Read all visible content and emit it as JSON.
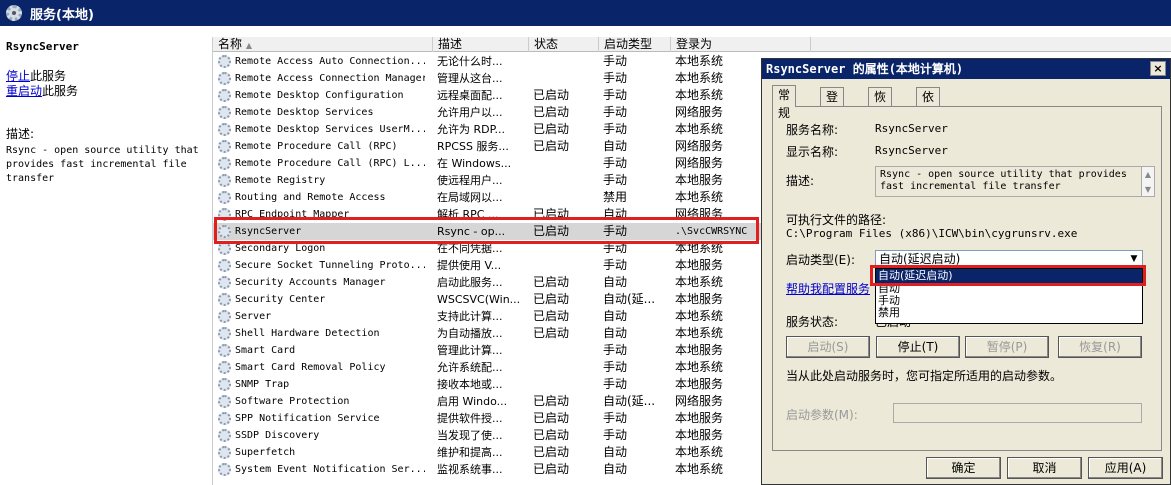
{
  "window": {
    "title": "服务(本地)",
    "icon": "gear-icon"
  },
  "left_pane": {
    "service_name": "RsyncServer",
    "stop_link": "停止",
    "stop_suffix": "此服务",
    "restart_link": "重启动",
    "restart_suffix": "此服务",
    "description_label": "描述:",
    "description": "Rsync - open source utility that provides fast incremental file transfer"
  },
  "columns": [
    "名称",
    "描述",
    "状态",
    "启动类型",
    "登录为"
  ],
  "rows": [
    {
      "name": "Remote Access Auto Connection...",
      "desc": "无论什么时...",
      "status": "",
      "startup": "手动",
      "logon": "本地系统"
    },
    {
      "name": "Remote Access Connection Manager",
      "desc": "管理从这台...",
      "status": "",
      "startup": "手动",
      "logon": "本地系统"
    },
    {
      "name": "Remote Desktop Configuration",
      "desc": "远程桌面配...",
      "status": "已启动",
      "startup": "手动",
      "logon": "本地系统"
    },
    {
      "name": "Remote Desktop Services",
      "desc": "允许用户以...",
      "status": "已启动",
      "startup": "手动",
      "logon": "网络服务"
    },
    {
      "name": "Remote Desktop Services UserM...",
      "desc": "允许为 RDP...",
      "status": "已启动",
      "startup": "手动",
      "logon": "本地系统"
    },
    {
      "name": "Remote Procedure Call (RPC)",
      "desc": "RPCSS 服务...",
      "status": "已启动",
      "startup": "自动",
      "logon": "网络服务"
    },
    {
      "name": "Remote Procedure Call (RPC) L...",
      "desc": "在 Windows...",
      "status": "",
      "startup": "手动",
      "logon": "网络服务"
    },
    {
      "name": "Remote Registry",
      "desc": "使远程用户...",
      "status": "",
      "startup": "手动",
      "logon": "本地服务"
    },
    {
      "name": "Routing and Remote Access",
      "desc": "在局域网以...",
      "status": "",
      "startup": "禁用",
      "logon": "本地系统"
    },
    {
      "name": "RPC Endpoint Mapper",
      "desc": "解析 RPC ...",
      "status": "已启动",
      "startup": "自动",
      "logon": "网络服务"
    },
    {
      "name": "RsyncServer",
      "desc": "Rsync - op...",
      "status": "已启动",
      "startup": "手动",
      "logon": ".\\SvcCWRSYNC",
      "selected": true
    },
    {
      "name": "Secondary Logon",
      "desc": "在不同凭据...",
      "status": "",
      "startup": "手动",
      "logon": "本地系统"
    },
    {
      "name": "Secure Socket Tunneling Proto...",
      "desc": "提供使用 V...",
      "status": "",
      "startup": "手动",
      "logon": "本地服务"
    },
    {
      "name": "Security Accounts Manager",
      "desc": "启动此服务...",
      "status": "已启动",
      "startup": "自动",
      "logon": "本地系统"
    },
    {
      "name": "Security Center",
      "desc": "WSCSVC(Win...",
      "status": "已启动",
      "startup": "自动(延...",
      "logon": "本地服务"
    },
    {
      "name": "Server",
      "desc": "支持此计算...",
      "status": "已启动",
      "startup": "自动",
      "logon": "本地系统"
    },
    {
      "name": "Shell Hardware Detection",
      "desc": "为自动播放...",
      "status": "已启动",
      "startup": "自动",
      "logon": "本地系统"
    },
    {
      "name": "Smart Card",
      "desc": "管理此计算...",
      "status": "",
      "startup": "手动",
      "logon": "本地服务"
    },
    {
      "name": "Smart Card Removal Policy",
      "desc": "允许系统配...",
      "status": "",
      "startup": "手动",
      "logon": "本地系统"
    },
    {
      "name": "SNMP Trap",
      "desc": "接收本地或...",
      "status": "",
      "startup": "手动",
      "logon": "本地服务"
    },
    {
      "name": "Software Protection",
      "desc": "启用 Windo...",
      "status": "已启动",
      "startup": "自动(延...",
      "logon": "网络服务"
    },
    {
      "name": "SPP Notification Service",
      "desc": "提供软件授...",
      "status": "已启动",
      "startup": "手动",
      "logon": "本地服务"
    },
    {
      "name": "SSDP Discovery",
      "desc": "当发现了使...",
      "status": "已启动",
      "startup": "手动",
      "logon": "本地服务"
    },
    {
      "name": "Superfetch",
      "desc": "维护和提高...",
      "status": "已启动",
      "startup": "自动",
      "logon": "本地系统"
    },
    {
      "name": "System Event Notification Ser...",
      "desc": "监视系统事...",
      "status": "已启动",
      "startup": "自动",
      "logon": "本地系统"
    }
  ],
  "dialog": {
    "title": "RsyncServer 的属性(本地计算机)",
    "close": "×",
    "tabs": [
      "常规",
      "登录",
      "恢复",
      "依存关系"
    ],
    "service_name_label": "服务名称:",
    "service_name": "RsyncServer",
    "display_name_label": "显示名称:",
    "display_name": "RsyncServer",
    "description_label": "描述:",
    "description": "Rsync - open source utility that provides fast incremental file transfer",
    "path_label": "可执行文件的路径:",
    "path": "C:\\Program Files (x86)\\ICW\\bin\\cygrunsrv.exe",
    "startup_type_label": "启动类型(E):",
    "startup_type_value": "自动(延迟启动)",
    "startup_options": [
      "自动(延迟启动)",
      "自动",
      "手动",
      "禁用"
    ],
    "help_link": "帮助我配置服务",
    "status_label": "服务状态:",
    "status_value": "已启动",
    "start_button": "启动(S)",
    "stop_button": "停止(T)",
    "pause_button": "暂停(P)",
    "resume_button": "恢复(R)",
    "hint": "当从此处启动服务时，您可指定所适用的启动参数。",
    "params_label": "启动参数(M):",
    "ok_button": "确定",
    "cancel_button": "取消",
    "apply_button": "应用(A)"
  }
}
